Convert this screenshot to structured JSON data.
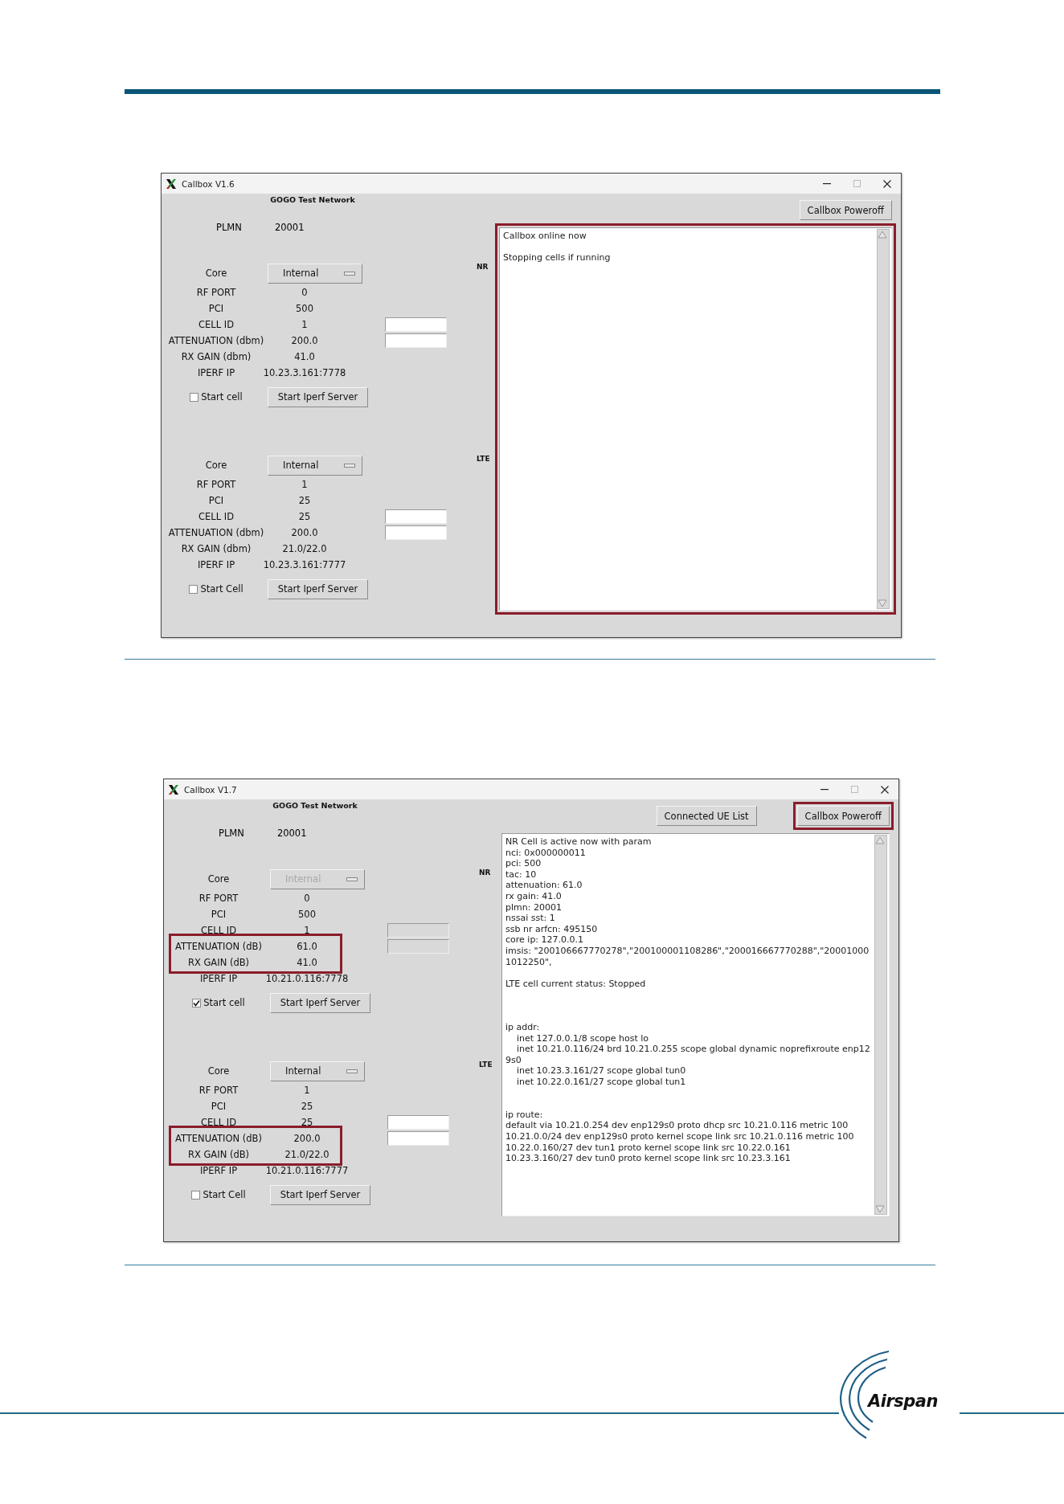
{
  "screenshots": [
    {
      "window": {
        "title": "Callbox V1.6"
      },
      "network": "GOGO Test Network",
      "plmn": {
        "label": "PLMN",
        "value": "20001"
      },
      "buttons": [
        {
          "label": "Callbox Poweroff",
          "highlighted": false
        }
      ],
      "cells": [
        {
          "tech": "NR",
          "core": {
            "label": "Core",
            "value": "Internal",
            "disabled": false
          },
          "fields_disabled": false,
          "rows": [
            {
              "kind": "value",
              "label": "RF PORT",
              "value": "0",
              "highlighted": false
            },
            {
              "kind": "value",
              "label": "PCI",
              "value": "500",
              "highlighted": false
            },
            {
              "kind": "field",
              "label": "CELL ID",
              "value": "1",
              "highlighted": false
            },
            {
              "kind": "field",
              "label": "ATTENUATION (dbm)",
              "value": "200.0",
              "highlighted": false
            },
            {
              "kind": "value",
              "label": "RX GAIN (dbm)",
              "value": "41.0",
              "highlighted": false
            },
            {
              "kind": "value",
              "label": "IPERF IP",
              "value": "10.23.3.161:7778",
              "highlighted": false
            }
          ],
          "start": {
            "label": "Start cell",
            "checked": false
          },
          "iperf_button": "Start Iperf Server"
        },
        {
          "tech": "LTE",
          "core": {
            "label": "Core",
            "value": "Internal",
            "disabled": false
          },
          "fields_disabled": false,
          "rows": [
            {
              "kind": "value",
              "label": "RF PORT",
              "value": "1",
              "highlighted": false
            },
            {
              "kind": "value",
              "label": "PCI",
              "value": "25",
              "highlighted": false
            },
            {
              "kind": "field",
              "label": "CELL ID",
              "value": "25",
              "highlighted": false
            },
            {
              "kind": "field",
              "label": "ATTENUATION (dbm)",
              "value": "200.0",
              "highlighted": false
            },
            {
              "kind": "value",
              "label": "RX GAIN (dbm)",
              "value": "21.0/22.0",
              "highlighted": false
            },
            {
              "kind": "value",
              "label": "IPERF IP",
              "value": "10.23.3.161:7777",
              "highlighted": false
            }
          ],
          "start": {
            "label": "Start Cell",
            "checked": false
          },
          "iperf_button": "Start Iperf Server"
        }
      ],
      "log": {
        "highlighted": true,
        "entries": [
          {
            "kind": "line",
            "text": "Callbox online now"
          },
          {
            "kind": "blank"
          },
          {
            "kind": "line",
            "text": "Stopping cells if running"
          }
        ]
      }
    },
    {
      "window": {
        "title": "Callbox V1.7"
      },
      "network": "GOGO Test Network",
      "plmn": {
        "label": "PLMN",
        "value": "20001"
      },
      "buttons": [
        {
          "label": "Connected UE List",
          "highlighted": false
        },
        {
          "label": "Callbox Poweroff",
          "highlighted": true
        }
      ],
      "cells": [
        {
          "tech": "NR",
          "core": {
            "label": "Core",
            "value": "Internal",
            "disabled": true
          },
          "fields_disabled": true,
          "rows": [
            {
              "kind": "value",
              "label": "RF PORT",
              "value": "0",
              "highlighted": false
            },
            {
              "kind": "value",
              "label": "PCI",
              "value": "500",
              "highlighted": false
            },
            {
              "kind": "field",
              "label": "CELL ID",
              "value": "1",
              "highlighted": false
            },
            {
              "kind": "field",
              "label": "ATTENUATION (dB)",
              "value": "61.0",
              "highlighted": true
            },
            {
              "kind": "value",
              "label": "RX GAIN (dB)",
              "value": "41.0",
              "highlighted": true
            },
            {
              "kind": "value",
              "label": "IPERF IP",
              "value": "10.21.0.116:7778",
              "highlighted": false
            }
          ],
          "start": {
            "label": "Start cell",
            "checked": true
          },
          "iperf_button": "Start Iperf Server"
        },
        {
          "tech": "LTE",
          "core": {
            "label": "Core",
            "value": "Internal",
            "disabled": false
          },
          "fields_disabled": false,
          "rows": [
            {
              "kind": "value",
              "label": "RF PORT",
              "value": "1",
              "highlighted": false
            },
            {
              "kind": "value",
              "label": "PCI",
              "value": "25",
              "highlighted": false
            },
            {
              "kind": "field",
              "label": "CELL ID",
              "value": "25",
              "highlighted": false
            },
            {
              "kind": "field",
              "label": "ATTENUATION (dB)",
              "value": "200.0",
              "highlighted": true
            },
            {
              "kind": "value",
              "label": "RX GAIN (dB)",
              "value": "21.0/22.0",
              "highlighted": true
            },
            {
              "kind": "value",
              "label": "IPERF IP",
              "value": "10.21.0.116:7777",
              "highlighted": false
            }
          ],
          "start": {
            "label": "Start Cell",
            "checked": false
          },
          "iperf_button": "Start Iperf Server"
        }
      ],
      "log": {
        "highlighted": false,
        "entries": [
          {
            "kind": "line",
            "text": "NR Cell is active now with param"
          },
          {
            "kind": "line",
            "text": "nci: 0x000000011"
          },
          {
            "kind": "line",
            "text": "pci: 500"
          },
          {
            "kind": "line",
            "text": "tac: 10"
          },
          {
            "kind": "line",
            "text": "attenuation: 61.0"
          },
          {
            "kind": "line",
            "text": "rx gain: 41.0"
          },
          {
            "kind": "line",
            "text": "plmn: 20001"
          },
          {
            "kind": "line",
            "text": "nssai sst: 1"
          },
          {
            "kind": "line",
            "text": "ssb nr arfcn: 495150"
          },
          {
            "kind": "line",
            "text": "core ip: 127.0.0.1"
          },
          {
            "kind": "line",
            "text": "imsis: \"200106667770278\",\"200100001108286\",\"200016667770288\",\"200010001012250\","
          },
          {
            "kind": "blank"
          },
          {
            "kind": "line",
            "text": "LTE cell current status: Stopped"
          },
          {
            "kind": "blank"
          },
          {
            "kind": "blank"
          },
          {
            "kind": "blank"
          },
          {
            "kind": "line",
            "text": "ip addr:"
          },
          {
            "kind": "line",
            "text": "    inet 127.0.0.1/8 scope host lo"
          },
          {
            "kind": "line",
            "text": "    inet 10.21.0.116/24 brd 10.21.0.255 scope global dynamic noprefixroute enp129s0"
          },
          {
            "kind": "line",
            "text": "    inet 10.23.3.161/27 scope global tun0"
          },
          {
            "kind": "line",
            "text": "    inet 10.22.0.161/27 scope global tun1"
          },
          {
            "kind": "blank"
          },
          {
            "kind": "blank"
          },
          {
            "kind": "line",
            "text": "ip route:"
          },
          {
            "kind": "line",
            "text": "default via 10.21.0.254 dev enp129s0 proto dhcp src 10.21.0.116 metric 100"
          },
          {
            "kind": "line",
            "text": "10.21.0.0/24 dev enp129s0 proto kernel scope link src 10.21.0.116 metric 100"
          },
          {
            "kind": "line",
            "text": "10.22.0.160/27 dev tun1 proto kernel scope link src 10.22.0.161"
          },
          {
            "kind": "line",
            "text": "10.23.3.160/27 dev tun0 proto kernel scope link src 10.23.3.161"
          }
        ]
      }
    }
  ],
  "footer": {
    "logo_text": "Airspan"
  }
}
